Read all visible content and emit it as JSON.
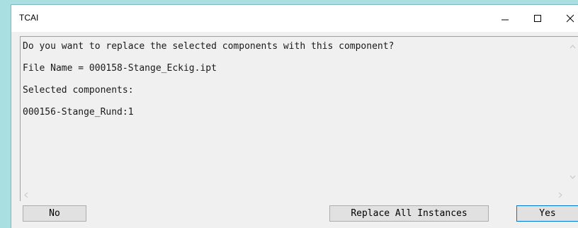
{
  "window": {
    "title": "TCAI"
  },
  "message": {
    "question": "Do you want to replace the selected components with this component?",
    "file_name": "File Name = 000158-Stange_Eckig.ipt",
    "selected_label": "Selected components:",
    "selected_item": "000156-Stange_Rund:1"
  },
  "buttons": {
    "no": "No",
    "replace_all": "Replace All Instances",
    "yes": "Yes"
  },
  "colors": {
    "desktop_bg": "#a9dfe0",
    "dialog_bg": "#f0f0f0",
    "default_button_border": "#0078d7"
  }
}
